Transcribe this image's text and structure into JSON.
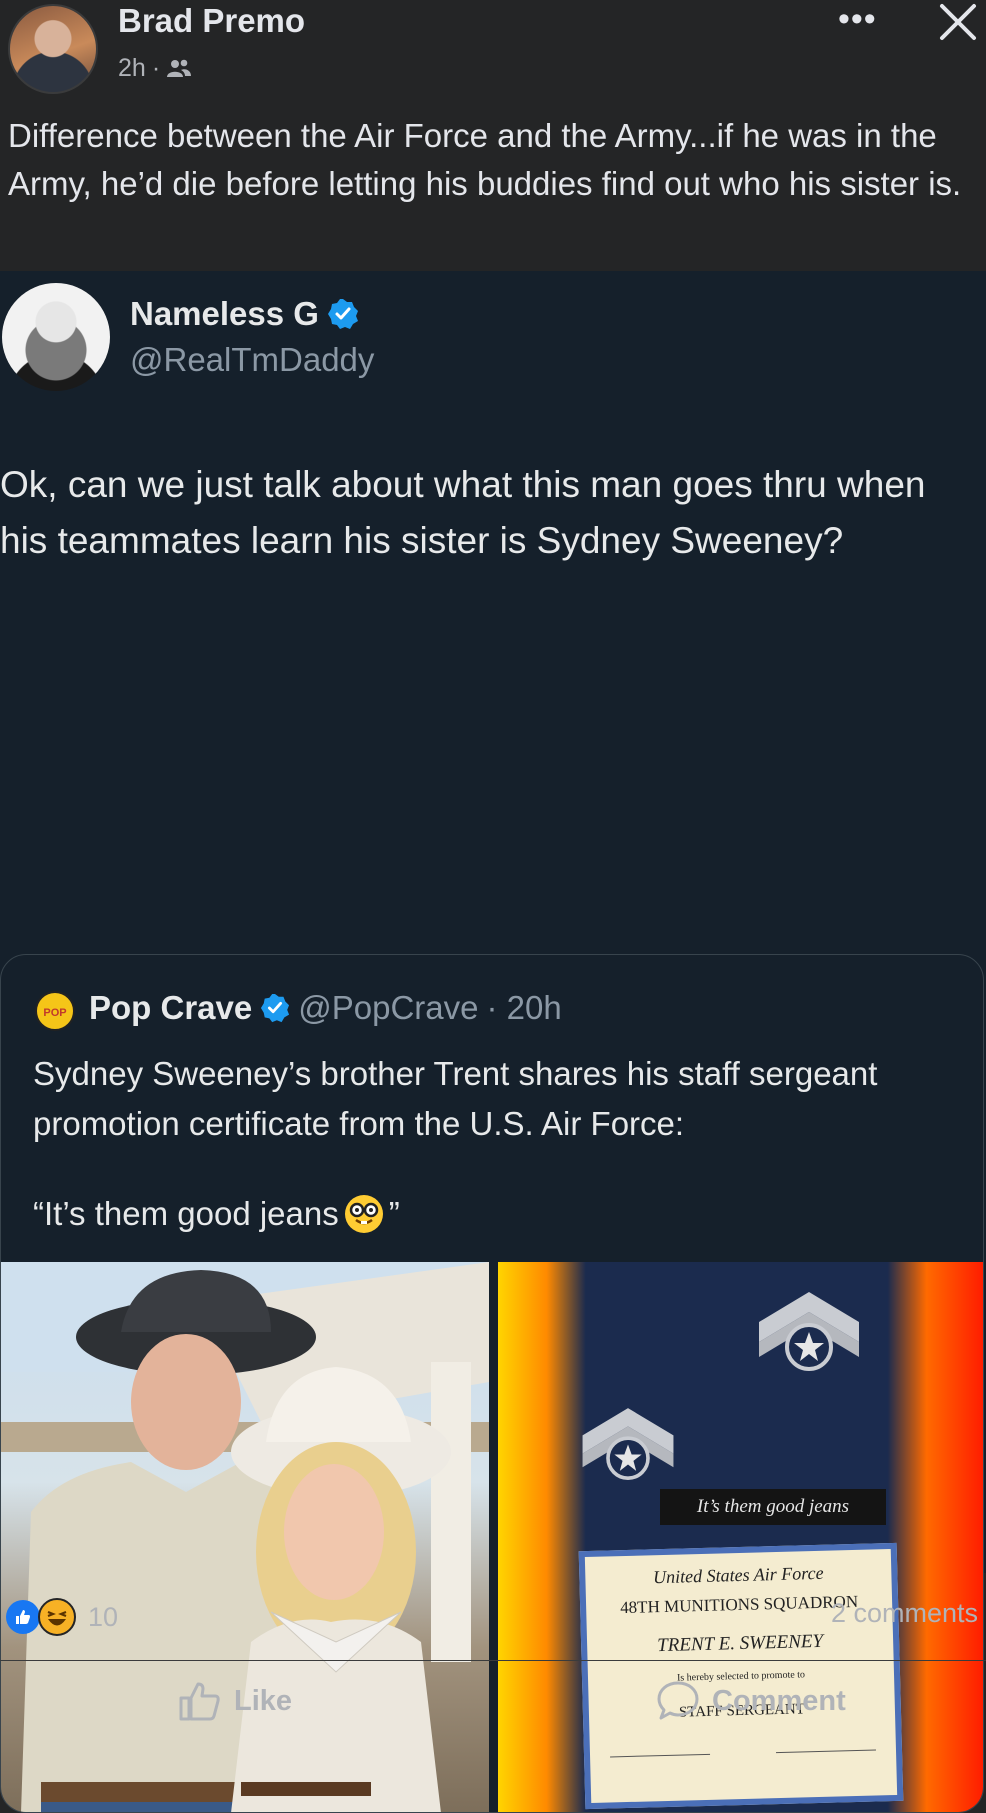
{
  "post": {
    "author": "Brad Premo",
    "time": "2h",
    "audience_separator": "·",
    "audience_icon": "friends-icon",
    "more_label": "•••",
    "text": "Difference between the Air Force and the Army...if he was in the Army, he’d die before letting his buddies find out who his sister is."
  },
  "tweet": {
    "name": "Nameless G",
    "handle": "@RealTmDaddy",
    "verified": true,
    "text": "Ok, can we just talk about what this man goes thru when his teammates learn his sister is Sydney Sweeney?",
    "quoted": {
      "logo_text": "POP",
      "name": "Pop Crave",
      "handle": "@PopCrave",
      "time": "· 20h",
      "text": "Sydney Sweeney’s brother Trent shares his staff sergeant promotion certificate from the U.S. Air Force:",
      "quote_open": "“It’s them good jeans",
      "quote_close": "”",
      "image_caption": "It’s them good jeans",
      "certificate": {
        "line1": "United States Air Force",
        "line2": "48TH MUNITIONS SQUADRON",
        "line3": "TRENT E. SWEENEY",
        "line4": "Is hereby selected to promote to",
        "line5": "STAFF SERGEANT"
      }
    }
  },
  "footer": {
    "reaction_count": "10",
    "comments": "2 comments",
    "like_label": "Like",
    "comment_label": "Comment"
  },
  "colors": {
    "fb_bg": "#242526",
    "tweet_bg": "#15202b",
    "verified": "#1d9bf0",
    "like_blue": "#1877f2"
  }
}
